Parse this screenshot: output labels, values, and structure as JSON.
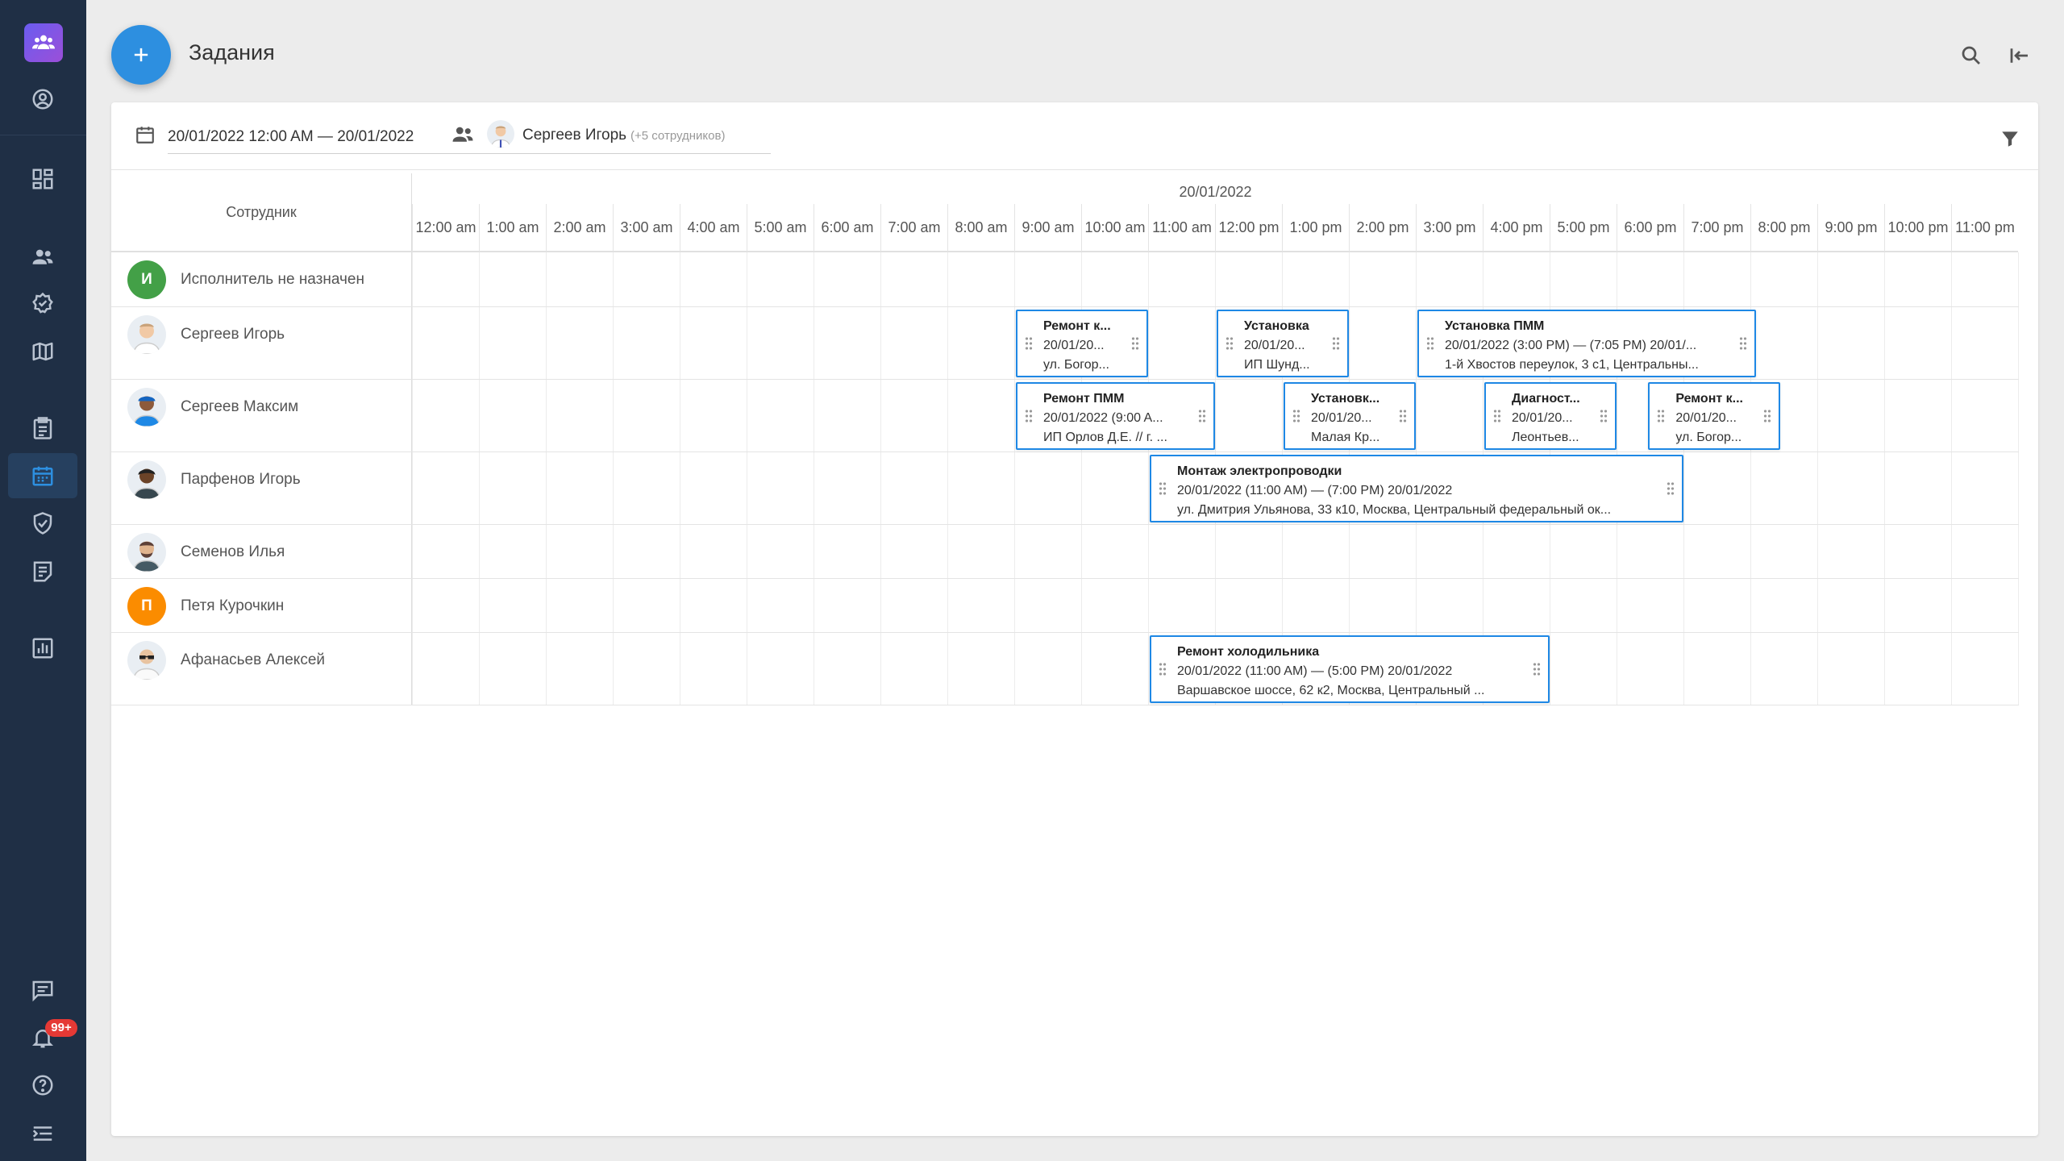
{
  "app": {
    "page_title": "Задания",
    "notifications_badge": "99+"
  },
  "sidebar": {
    "icons": [
      "team-logo-icon",
      "account-circle-icon",
      "dashboard-icon",
      "people-icon",
      "badge-check-icon",
      "map-icon",
      "clipboard-icon",
      "calendar-icon",
      "task-check-icon",
      "notes-icon",
      "chart-icon",
      "chat-icon",
      "bell-icon",
      "help-icon",
      "collapse-menu-icon"
    ],
    "active": "calendar-icon"
  },
  "filters": {
    "date_range": "20/01/2022 12:00 AM — 20/01/2022",
    "employee": "Сергеев Игорь",
    "employee_extra": "(+5 сотрудников)"
  },
  "scheduler": {
    "employee_column_header": "Сотрудник",
    "date": "20/01/2022",
    "hours": [
      "12:00 am",
      "1:00 am",
      "2:00 am",
      "3:00 am",
      "4:00 am",
      "5:00 am",
      "6:00 am",
      "7:00 am",
      "8:00 am",
      "9:00 am",
      "10:00 am",
      "11:00 am",
      "12:00 pm",
      "1:00 pm",
      "2:00 pm",
      "3:00 pm",
      "4:00 pm",
      "5:00 pm",
      "6:00 pm",
      "7:00 pm",
      "8:00 pm",
      "9:00 pm",
      "10:00 pm",
      "11:00 pm"
    ],
    "employees": [
      {
        "name": "Исполнитель не назначен",
        "initial": "И",
        "color": "#43a047",
        "avatar": "letter"
      },
      {
        "name": "Сергеев Игорь",
        "avatar": "photo-doctor"
      },
      {
        "name": "Сергеев Максим",
        "avatar": "photo-cap"
      },
      {
        "name": "Парфенов Игорь",
        "avatar": "photo-dark"
      },
      {
        "name": "Семенов Илья",
        "avatar": "photo-beard"
      },
      {
        "name": "Петя Курочкин",
        "initial": "П",
        "color": "#fb8c00",
        "avatar": "letter"
      },
      {
        "name": "Афанасьев Алексей",
        "avatar": "photo-glasses"
      }
    ],
    "tasks": [
      {
        "row": 1,
        "start": 9,
        "end": 11,
        "title": "Ремонт к...",
        "time": "20/01/20...",
        "address": "ул. Богор..."
      },
      {
        "row": 1,
        "start": 12,
        "end": 14,
        "title": "Установка",
        "time": "20/01/20...",
        "address": "ИП Шунд..."
      },
      {
        "row": 1,
        "start": 15,
        "end": 20.08,
        "title": "Установка ПММ",
        "time": "20/01/2022 (3:00 PM) — (7:05 PM) 20/01/...",
        "address": "1-й Хвостов переулок, 3 с1, Центральны..."
      },
      {
        "row": 2,
        "start": 9,
        "end": 12,
        "title": "Ремонт ПММ",
        "time": "20/01/2022 (9:00 A...",
        "address": "ИП Орлов Д.Е. // г. ..."
      },
      {
        "row": 2,
        "start": 13,
        "end": 15,
        "title": "Установк...",
        "time": "20/01/20...",
        "address": "Малая Кр..."
      },
      {
        "row": 2,
        "start": 16,
        "end": 18,
        "title": "Диагност...",
        "time": "20/01/20...",
        "address": "Леонтьев..."
      },
      {
        "row": 2,
        "start": 18.45,
        "end": 20.45,
        "title": "Ремонт к...",
        "time": "20/01/20...",
        "address": "ул. Богор..."
      },
      {
        "row": 3,
        "start": 11,
        "end": 19,
        "title": "Монтаж электропроводки",
        "time": "20/01/2022 (11:00 AM) — (7:00 PM) 20/01/2022",
        "address": "ул. Дмитрия Ульянова, 33 к10, Москва, Центральный федеральный ок..."
      },
      {
        "row": 6,
        "start": 11,
        "end": 17,
        "title": "Ремонт холодильника",
        "time": "20/01/2022 (11:00 AM) — (5:00 PM) 20/01/2022",
        "address": "Варшавское шоссе, 62 к2, Москва, Центральный ..."
      }
    ]
  },
  "colors": {
    "accent": "#1e88e5",
    "sidebar": "#1f2f45",
    "fab": "#2d8fe0"
  }
}
